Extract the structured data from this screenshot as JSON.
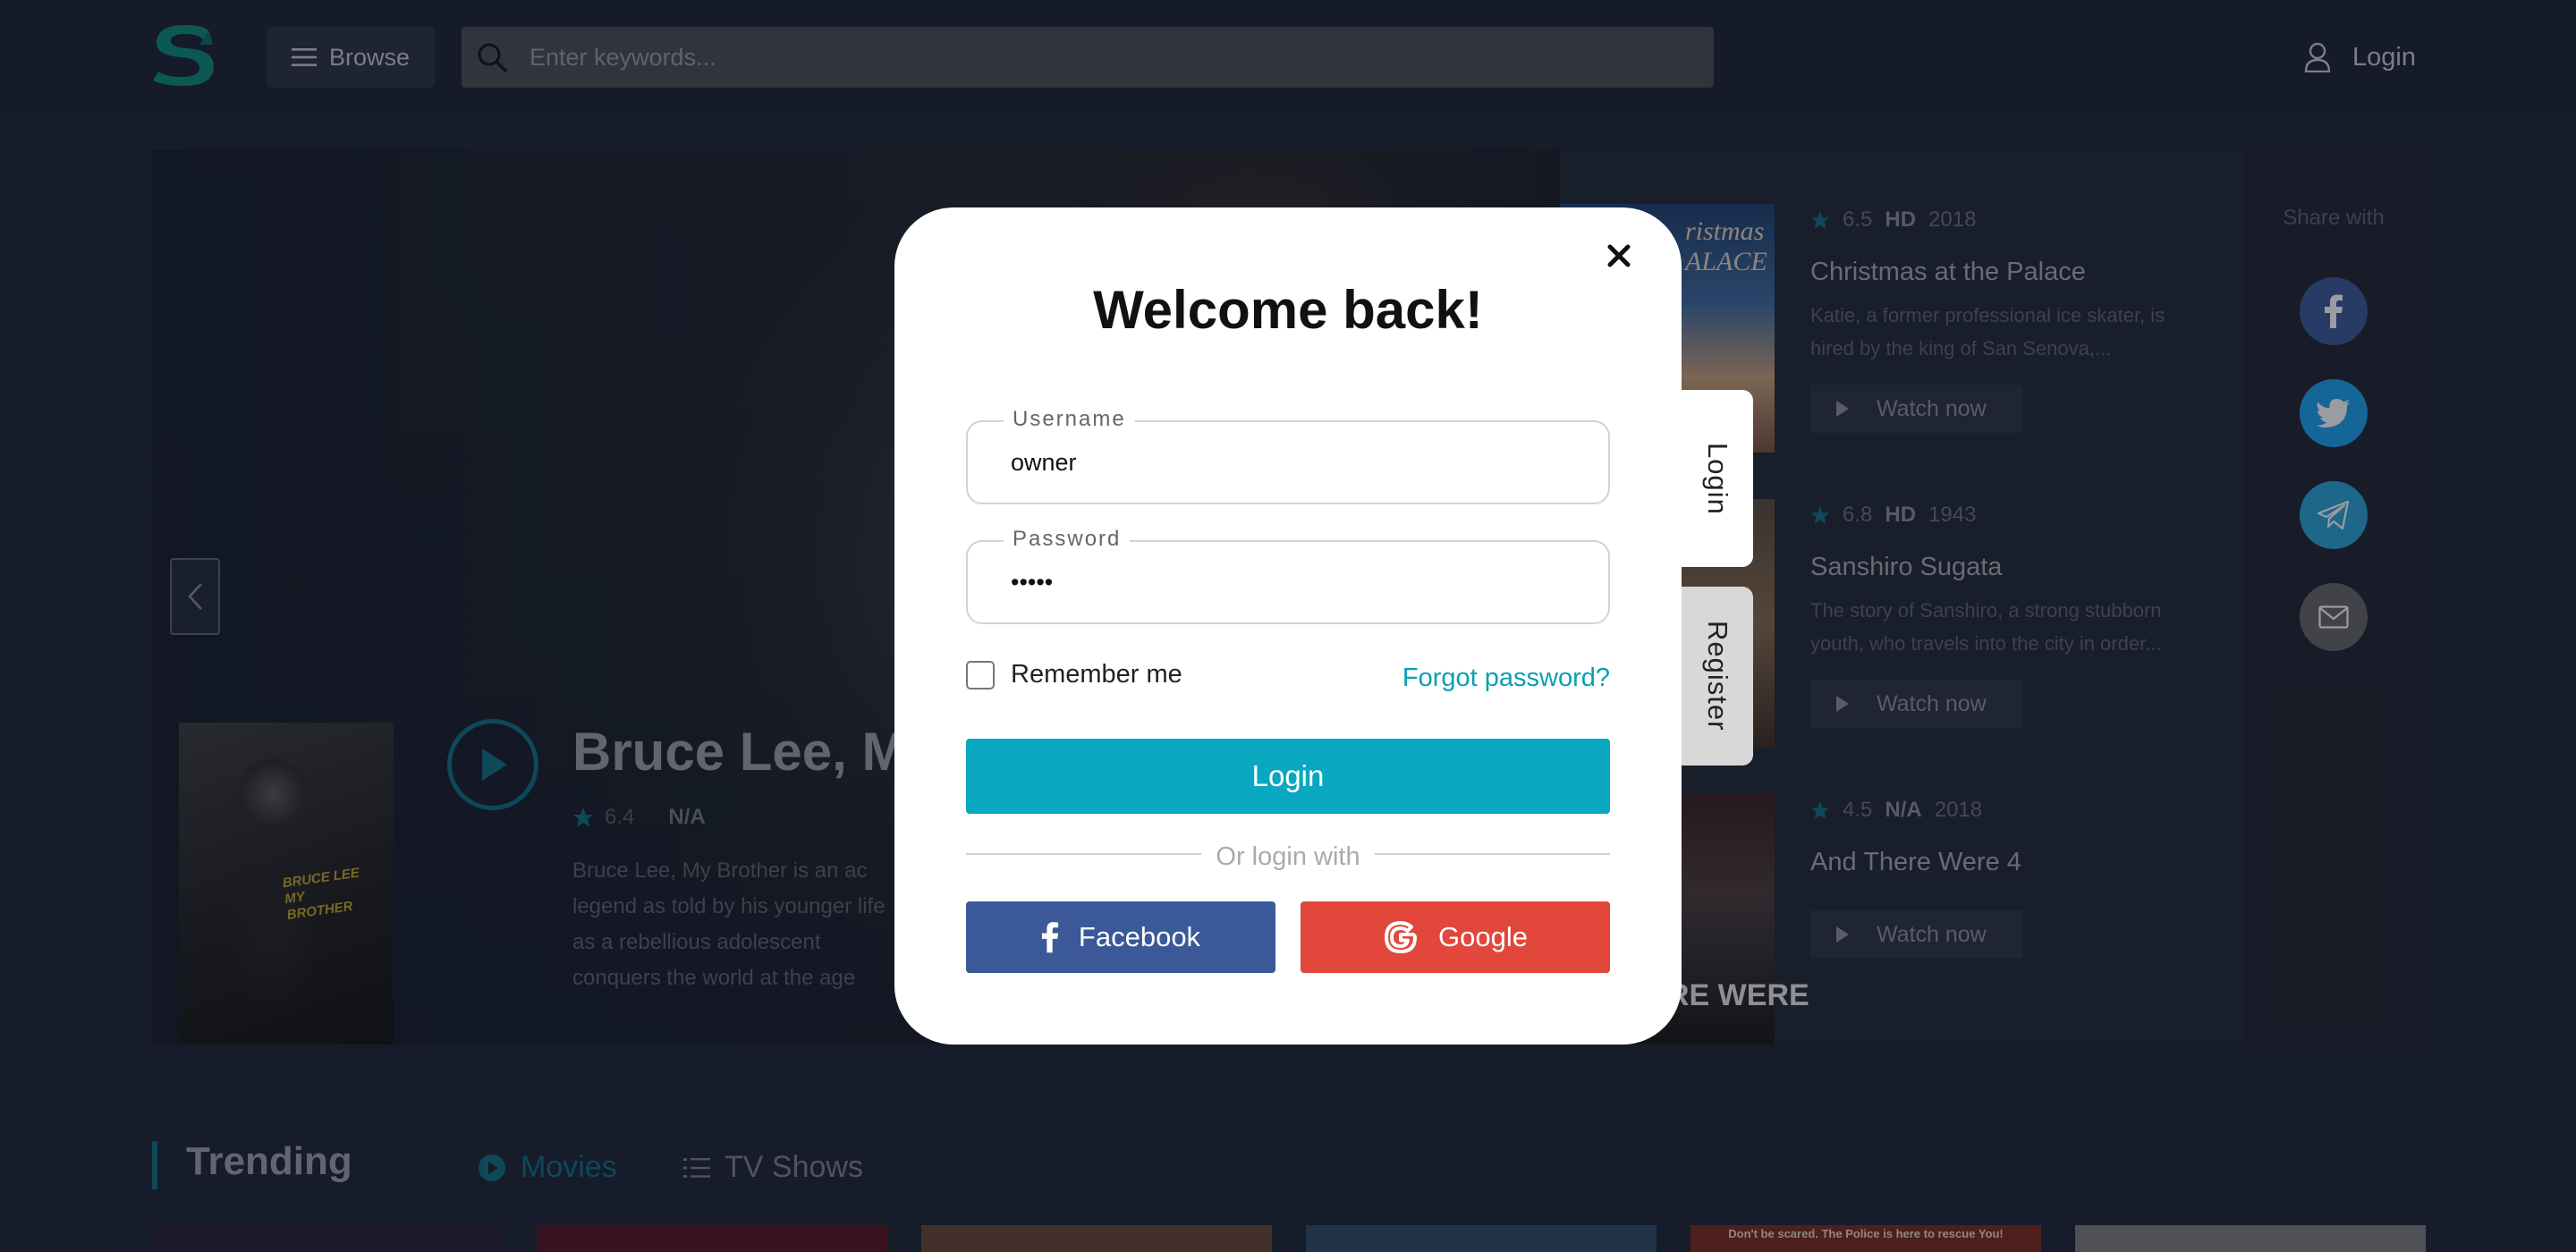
{
  "header": {
    "browse_label": "Browse",
    "search_placeholder": "Enter keywords...",
    "login_label": "Login"
  },
  "hero": {
    "title": "Bruce Lee, M",
    "rating": "6.4",
    "quality": "N/A",
    "description": "Bruce Lee, My Brother is an ac legend as told by his younger life as a rebellious adolescent conquers the world at the age",
    "poster_text": "BRUCE LEE MY BROTHER"
  },
  "side_list": {
    "items": [
      {
        "rating": "6.5",
        "quality": "HD",
        "year": "2018",
        "title": "Christmas at the Palace",
        "description": "Katie, a former professional ice skater, is hired by the king of San Senova,...",
        "watch_label": "Watch now",
        "thumb_text": "ristmas ALACE"
      },
      {
        "rating": "6.8",
        "quality": "HD",
        "year": "1943",
        "title": "Sanshiro Sugata",
        "description": "The story of Sanshiro, a strong stubborn youth, who travels into the city in order...",
        "watch_label": "Watch now"
      },
      {
        "rating": "4.5",
        "quality": "N/A",
        "year": "2018",
        "title": "And There Were 4",
        "description": "",
        "watch_label": "Watch now",
        "thumb_text": "RE WERE"
      }
    ]
  },
  "share": {
    "title": "Share with",
    "buttons": [
      {
        "name": "facebook",
        "color": "#3b5998"
      },
      {
        "name": "twitter",
        "color": "#1da1f2"
      },
      {
        "name": "telegram",
        "color": "#2aa3d8"
      },
      {
        "name": "email",
        "color": "#666666"
      }
    ]
  },
  "trending": {
    "title": "Trending",
    "tabs": [
      {
        "label": "Movies",
        "active": true
      },
      {
        "label": "TV Shows",
        "active": false
      }
    ],
    "card_caption": "Don't be scared. The Police is here to rescue You!"
  },
  "modal": {
    "title": "Welcome back!",
    "username_label": "Username",
    "username_value": "owner",
    "password_label": "Password",
    "password_value": "•••••",
    "remember_label": "Remember me",
    "forgot_label": "Forgot password?",
    "login_button": "Login",
    "divider_text": "Or login with",
    "facebook_label": "Facebook",
    "google_label": "Google",
    "side_tabs": [
      "Login",
      "Register"
    ]
  },
  "colors": {
    "accent": "#0aa8c0",
    "facebook": "#3b5998",
    "google": "#e1473b",
    "background": "#1d2431"
  }
}
